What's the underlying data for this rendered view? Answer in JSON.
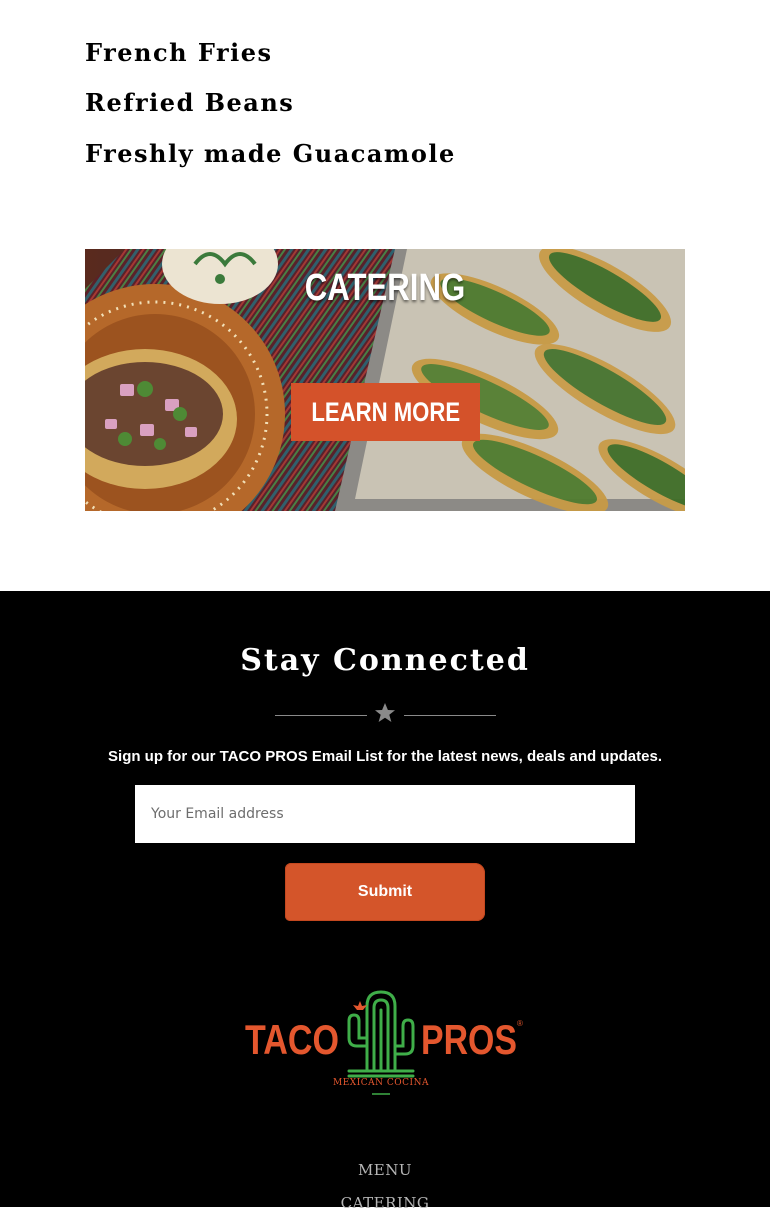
{
  "sides": {
    "items": [
      "French Fries",
      "Refried Beans",
      "Freshly made Guacamole"
    ]
  },
  "catering_banner": {
    "title": "CATERING",
    "button_label": "LEARN MORE"
  },
  "footer": {
    "heading": "Stay Connected",
    "signup_text": "Sign up for our TACO PROS Email List for the latest news, deals and updates.",
    "email_placeholder": "Your Email address",
    "submit_label": "Submit",
    "logo": {
      "left_text": "TACO",
      "right_text": "PROS",
      "trademark": "®",
      "tagline": "MEXICAN COCINA"
    },
    "nav": [
      "MENU",
      "CATERING"
    ]
  },
  "colors": {
    "accent": "#d4552a",
    "logo_green": "#3fae49",
    "logo_orange": "#e4572e",
    "footer_bg": "#000000"
  }
}
